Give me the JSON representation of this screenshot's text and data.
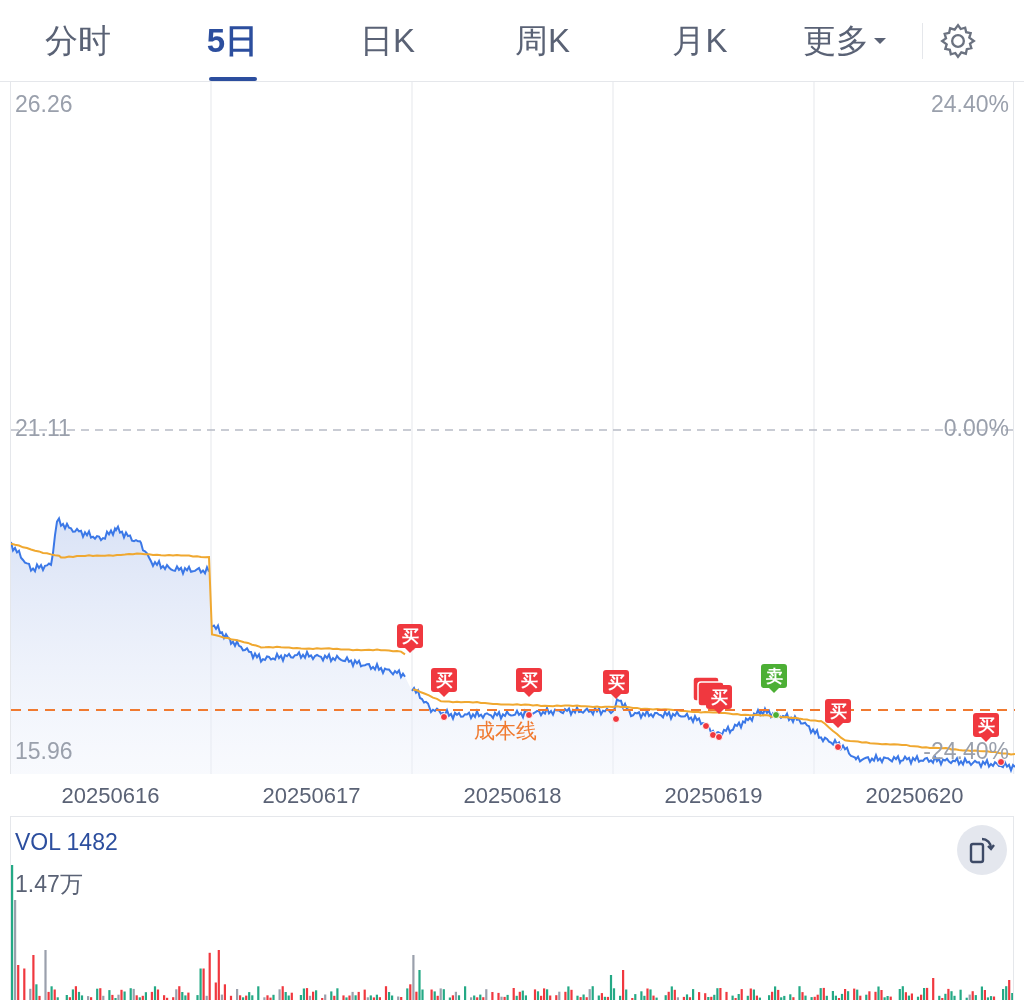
{
  "tabs": [
    {
      "label": "分时",
      "selected": false,
      "kind": "tab"
    },
    {
      "label": "5日",
      "selected": true,
      "kind": "tab"
    },
    {
      "label": "日K",
      "selected": false,
      "kind": "tab"
    },
    {
      "label": "周K",
      "selected": false,
      "kind": "tab"
    },
    {
      "label": "月K",
      "selected": false,
      "kind": "tab"
    },
    {
      "label": "更多",
      "selected": false,
      "kind": "dropdown"
    }
  ],
  "price_chart": {
    "left_axis": [
      "26.26",
      "21.11",
      "15.96"
    ],
    "right_axis": [
      "24.40%",
      "0.00%",
      "-24.40%"
    ],
    "dates": [
      "20250616",
      "20250617",
      "20250618",
      "20250619",
      "20250620"
    ],
    "cost_line": {
      "label": "成本线"
    },
    "markers": [
      {
        "label": "买",
        "color": "#f0383f"
      },
      {
        "label": "买",
        "color": "#f0383f"
      },
      {
        "label": "买",
        "color": "#f0383f"
      },
      {
        "label": "买",
        "color": "#f0383f"
      },
      {
        "label": "买",
        "color": "#f0383f"
      },
      {
        "label": "卖",
        "color": "#4caf35"
      },
      {
        "label": "买",
        "color": "#f0383f"
      },
      {
        "label": "买",
        "color": "#f0383f"
      }
    ]
  },
  "volume": {
    "title": "VOL 1482",
    "max_label": "1.47万"
  }
}
